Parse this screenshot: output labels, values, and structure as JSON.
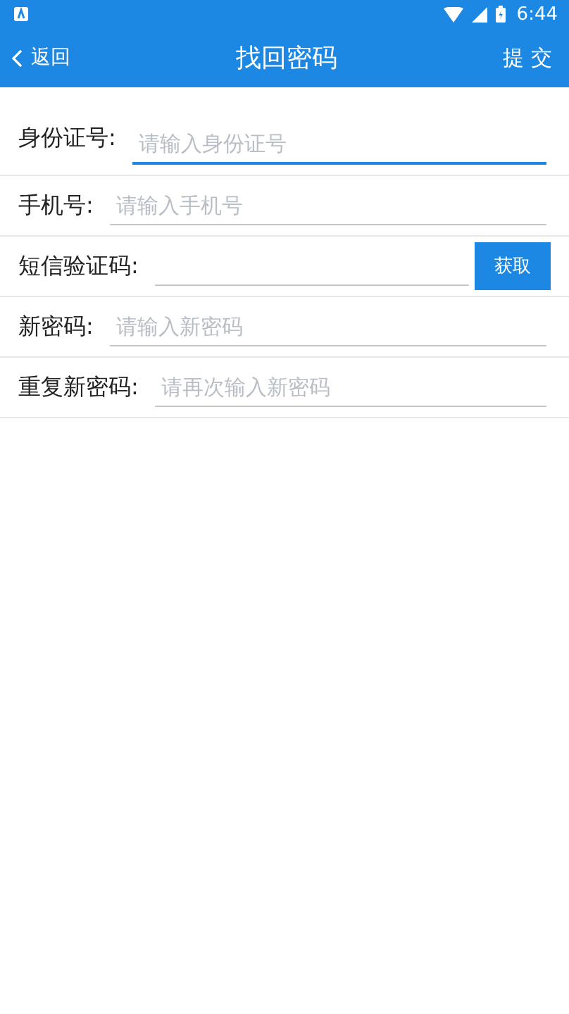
{
  "status_bar": {
    "time": "6:44"
  },
  "app_bar": {
    "back": "返回",
    "title": "找回密码",
    "action": "提 交"
  },
  "fields": [
    {
      "label": "身份证号:",
      "placeholder": "请输入身份证号",
      "focused": true
    },
    {
      "label": "手机号:",
      "placeholder": "请输入手机号",
      "focused": false
    },
    {
      "label": "短信验证码:",
      "focused": false,
      "button": "获取"
    },
    {
      "label": "新密码:",
      "placeholder": "请输入新密码",
      "focused": false
    },
    {
      "label": "重复新密码:",
      "placeholder": "请再次输入新密码",
      "focused": false
    }
  ]
}
